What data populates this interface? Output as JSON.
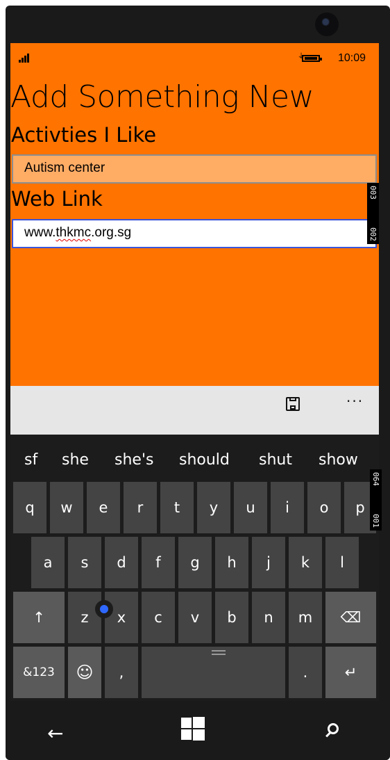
{
  "status_bar": {
    "time": "10:09",
    "signal_icon": "signal-bars-icon",
    "battery_icon": "battery-charging-icon"
  },
  "page": {
    "title": "Add Something New",
    "activities_label": "Activties I Like",
    "activities_value": "Autism center",
    "weblink_label": "Web Link",
    "weblink_value_prefix": "www.",
    "weblink_value_misspelled": "thkmc",
    "weblink_value_suffix": ".org.sg"
  },
  "debug_tags": {
    "top": [
      "003",
      "002"
    ],
    "keyboard": [
      "064",
      "001"
    ]
  },
  "app_bar": {
    "save_icon": "save-icon",
    "more_label": "···"
  },
  "keyboard": {
    "suggestions": [
      "sf",
      "she",
      "she's",
      "should",
      "shut",
      "show"
    ],
    "row1": [
      "q",
      "w",
      "e",
      "r",
      "t",
      "y",
      "u",
      "i",
      "o",
      "p"
    ],
    "row2": [
      "a",
      "s",
      "d",
      "f",
      "g",
      "h",
      "j",
      "k",
      "l"
    ],
    "row3": [
      "↑",
      "z",
      "x",
      "c",
      "v",
      "b",
      "n",
      "m",
      "⌫"
    ],
    "row4": {
      "numbers_label": "&123",
      "emoji": "☺",
      "comma": ",",
      "space": "",
      "period": ".",
      "enter": "↵"
    }
  },
  "nav_bar": {
    "back_icon": "←",
    "windows_icon": "windows-logo-icon",
    "search_icon": "search-icon"
  },
  "colors": {
    "accent": "#ff7300",
    "field_active_border": "#3b55d9",
    "cursor": "#2f68ff"
  }
}
